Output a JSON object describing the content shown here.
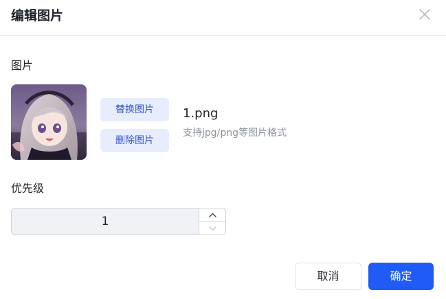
{
  "dialog": {
    "title": "编辑图片"
  },
  "image_section": {
    "label": "图片",
    "replace_label": "替换图片",
    "delete_label": "删除图片",
    "filename": "1.png",
    "hint": "支持jpg/png等图片格式"
  },
  "priority": {
    "label": "优先级",
    "value": "1"
  },
  "footer": {
    "cancel_label": "取消",
    "ok_label": "确定"
  },
  "icons": {
    "close": "close-icon",
    "up": "chevron-up-icon",
    "down": "chevron-down-icon"
  },
  "colors": {
    "accent": "#1f5cf5",
    "light_button_bg": "#e8edfd",
    "light_button_text": "#3457c8"
  }
}
